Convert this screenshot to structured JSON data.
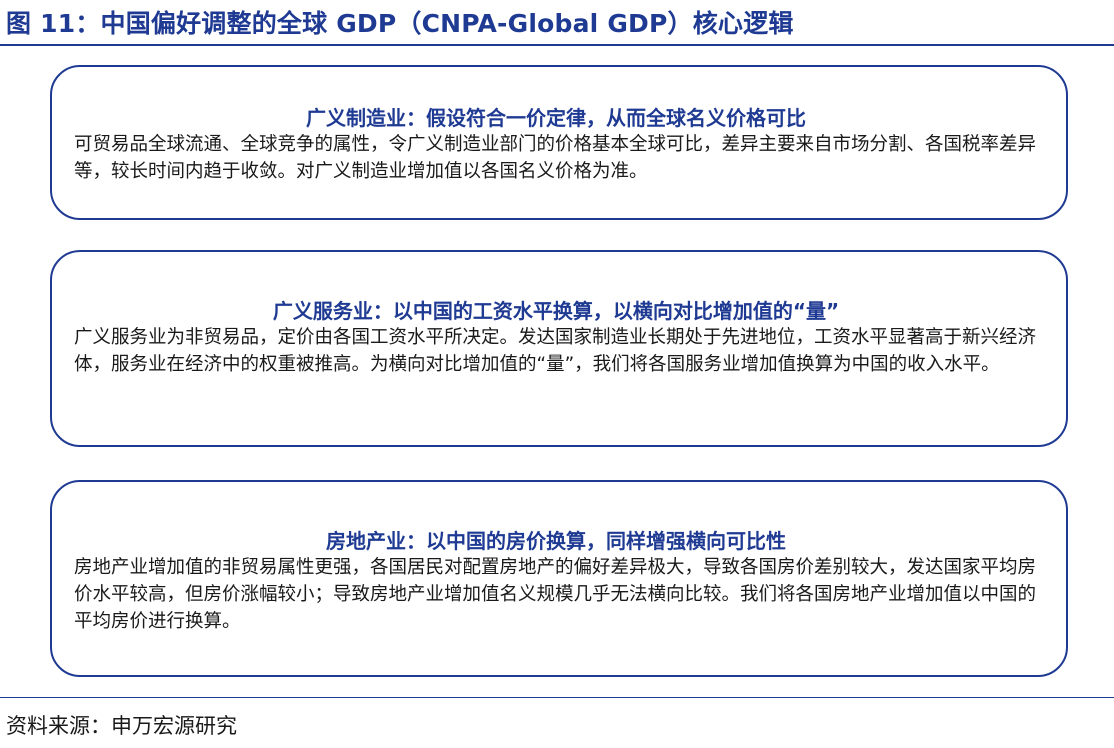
{
  "figure": {
    "title": "图 11：中国偏好调整的全球 GDP（CNPA-Global GDP）核心逻辑"
  },
  "boxes": [
    {
      "heading": "广义制造业：假设符合一价定律，从而全球名义价格可比",
      "body": "可贸易品全球流通、全球竞争的属性，令广义制造业部门的价格基本全球可比，差异主要来自市场分割、各国税率差异等，较长时间内趋于收敛。对广义制造业增加值以各国名义价格为准。"
    },
    {
      "heading": "广义服务业：以中国的工资水平换算，以横向对比增加值的“量”",
      "body": "广义服务业为非贸易品，定价由各国工资水平所决定。发达国家制造业长期处于先进地位，工资水平显著高于新兴经济体，服务业在经济中的权重被推高。为横向对比增加值的“量”，我们将各国服务业增加值换算为中国的收入水平。"
    },
    {
      "heading": "房地产业：以中国的房价换算，同样增强横向可比性",
      "body": "房地产业增加值的非贸易属性更强，各国居民对配置房地产的偏好差异极大，导致各国房价差别较大，发达国家平均房价水平较高，但房价涨幅较小；导致房地产业增加值名义规模几乎无法横向比较。我们将各国房地产业增加值以中国的平均房价进行换算。"
    }
  ],
  "footer": {
    "source": "资料来源：申万宏源研究"
  },
  "colors": {
    "accent": "#1f3a93",
    "text": "#1a1a1a"
  }
}
